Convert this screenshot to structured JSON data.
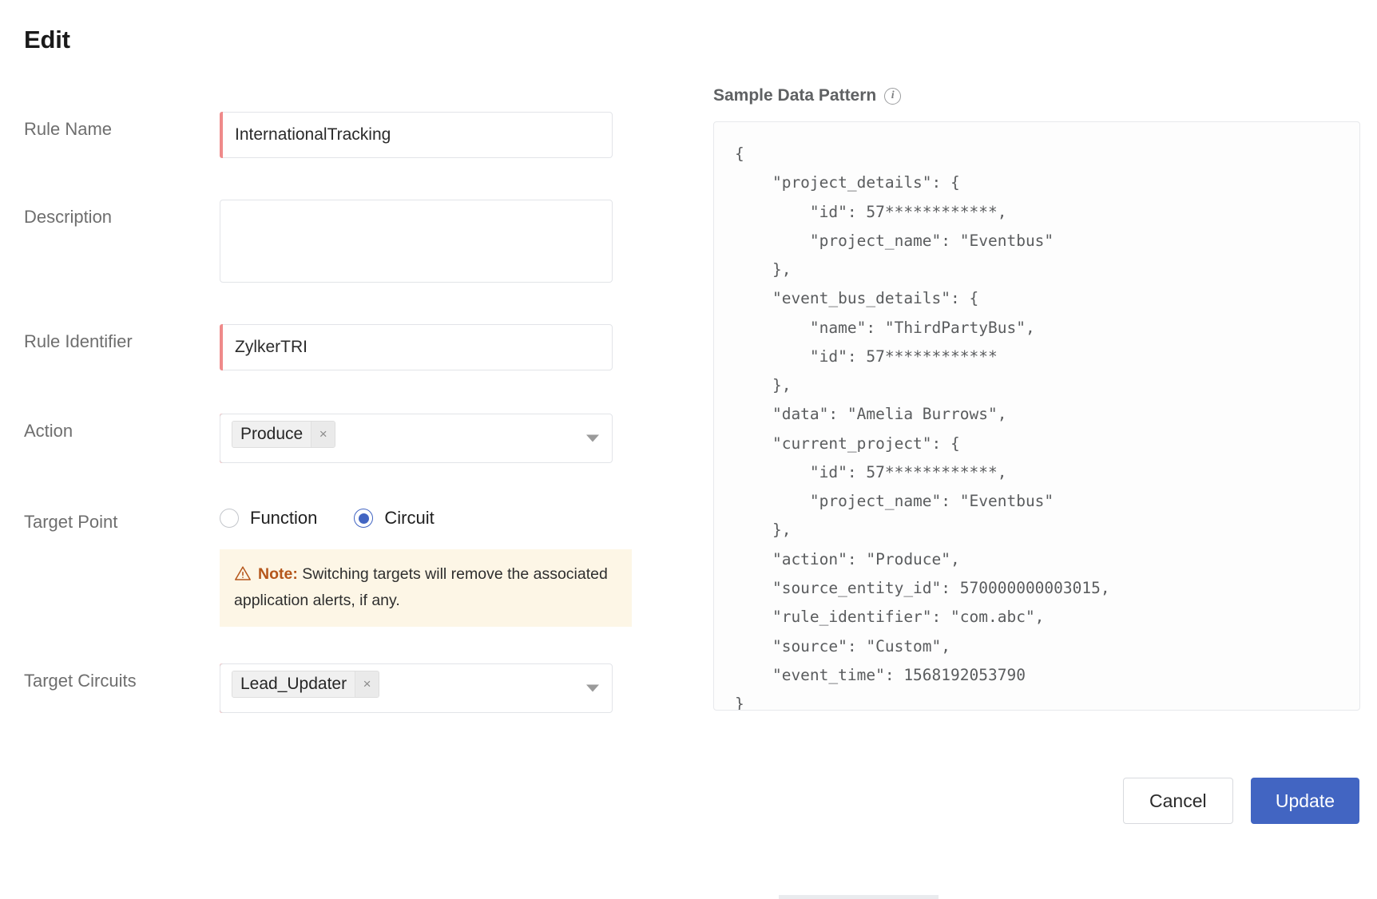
{
  "header": {
    "title": "Edit"
  },
  "form": {
    "fields": {
      "rule_name": {
        "label": "Rule Name",
        "value": "InternationalTracking",
        "placeholder": ""
      },
      "description": {
        "label": "Description",
        "value": "",
        "placeholder": ""
      },
      "rule_identifier": {
        "label": "Rule Identifier",
        "value": "ZylkerTRI",
        "placeholder": ""
      },
      "action": {
        "label": "Action",
        "chip": "Produce",
        "remove_label": "×"
      },
      "target_point": {
        "label": "Target Point",
        "options": [
          {
            "label": "Function",
            "selected": false
          },
          {
            "label": "Circuit",
            "selected": true
          }
        ]
      },
      "target_circuits": {
        "label": "Target Circuits",
        "chip": "Lead_Updater",
        "remove_label": "×"
      }
    },
    "note": {
      "strong": "Note:",
      "text": " Switching targets will remove the associated application alerts, if any.",
      "icon": "warning-triangle-icon"
    }
  },
  "sample_data_pattern": {
    "title": "Sample Data Pattern",
    "info_icon": "info-icon",
    "json": "{\n    \"project_details\": {\n        \"id\": 57************,\n        \"project_name\": \"Eventbus\"\n    },\n    \"event_bus_details\": {\n        \"name\": \"ThirdPartyBus\",\n        \"id\": 57************\n    },\n    \"data\": \"Amelia Burrows\",\n    \"current_project\": {\n        \"id\": 57************,\n        \"project_name\": \"Eventbus\"\n    },\n    \"action\": \"Produce\",\n    \"source_entity_id\": 570000000003015,\n    \"rule_identifier\": \"com.abc\",\n    \"source\": \"Custom\",\n    \"event_time\": 1568192053790\n}"
  },
  "footer": {
    "cancel_label": "Cancel",
    "update_label": "Update"
  },
  "colors": {
    "accent_blue": "#4265c2",
    "required_red": "#ef8a8a",
    "note_bg": "#fdf6e6",
    "note_accent": "#b5561b"
  }
}
